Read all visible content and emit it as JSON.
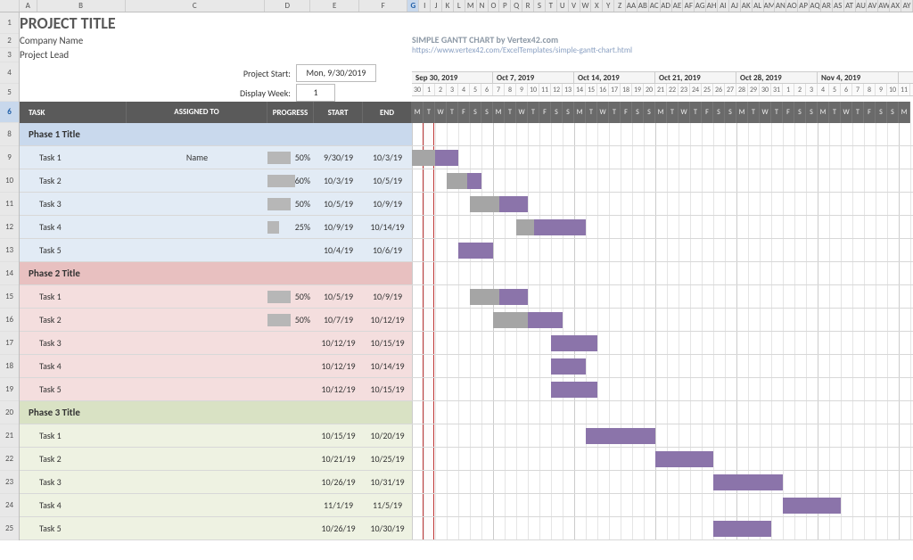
{
  "chart_data": {
    "type": "bar",
    "orientation": "horizontal-gantt",
    "title": "PROJECT TITLE",
    "x_axis": "date",
    "x_start": "2019-09-30",
    "x_end": "2019-11-11",
    "weeks": [
      "Sep 30, 2019",
      "Oct 7, 2019",
      "Oct 14, 2019",
      "Oct 21, 2019",
      "Oct 28, 2019",
      "Nov 4, 2019"
    ],
    "day_numbers": [
      30,
      1,
      2,
      3,
      4,
      5,
      6,
      7,
      8,
      9,
      10,
      11,
      12,
      13,
      14,
      15,
      16,
      17,
      18,
      19,
      20,
      21,
      22,
      23,
      24,
      25,
      26,
      27,
      28,
      29,
      30,
      31,
      1,
      2,
      3,
      4,
      5,
      6,
      7,
      8,
      9,
      10,
      11
    ],
    "dow": [
      "M",
      "T",
      "W",
      "T",
      "F",
      "S",
      "S",
      "M",
      "T",
      "W",
      "T",
      "F",
      "S",
      "S",
      "M",
      "T",
      "W",
      "T",
      "F",
      "S",
      "S",
      "M",
      "T",
      "W",
      "T",
      "F",
      "S",
      "S",
      "M",
      "T",
      "W",
      "T",
      "F",
      "S",
      "S",
      "M",
      "T",
      "W",
      "T",
      "F",
      "S",
      "S",
      "M"
    ],
    "series": [
      {
        "phase": "Phase 1 Title",
        "tasks": [
          {
            "name": "Task 1",
            "assigned": "Name",
            "progress": 50,
            "start": "9/30/19",
            "end": "10/3/19",
            "start_i": 0,
            "dur": 4
          },
          {
            "name": "Task 2",
            "assigned": "",
            "progress": 60,
            "start": "10/3/19",
            "end": "10/5/19",
            "start_i": 3,
            "dur": 3
          },
          {
            "name": "Task 3",
            "assigned": "",
            "progress": 50,
            "start": "10/5/19",
            "end": "10/9/19",
            "start_i": 5,
            "dur": 5
          },
          {
            "name": "Task 4",
            "assigned": "",
            "progress": 25,
            "start": "10/9/19",
            "end": "10/14/19",
            "start_i": 9,
            "dur": 6
          },
          {
            "name": "Task 5",
            "assigned": "",
            "progress": null,
            "start": "10/4/19",
            "end": "10/6/19",
            "start_i": 4,
            "dur": 3
          }
        ]
      },
      {
        "phase": "Phase 2 Title",
        "tasks": [
          {
            "name": "Task 1",
            "assigned": "",
            "progress": 50,
            "start": "10/5/19",
            "end": "10/9/19",
            "start_i": 5,
            "dur": 5
          },
          {
            "name": "Task 2",
            "assigned": "",
            "progress": 50,
            "start": "10/7/19",
            "end": "10/12/19",
            "start_i": 7,
            "dur": 6
          },
          {
            "name": "Task 3",
            "assigned": "",
            "progress": null,
            "start": "10/12/19",
            "end": "10/15/19",
            "start_i": 12,
            "dur": 4
          },
          {
            "name": "Task 4",
            "assigned": "",
            "progress": null,
            "start": "10/12/19",
            "end": "10/14/19",
            "start_i": 12,
            "dur": 3
          },
          {
            "name": "Task 5",
            "assigned": "",
            "progress": null,
            "start": "10/12/19",
            "end": "10/15/19",
            "start_i": 12,
            "dur": 4
          }
        ]
      },
      {
        "phase": "Phase 3 Title",
        "tasks": [
          {
            "name": "Task 1",
            "assigned": "",
            "progress": null,
            "start": "10/15/19",
            "end": "10/20/19",
            "start_i": 15,
            "dur": 6
          },
          {
            "name": "Task 2",
            "assigned": "",
            "progress": null,
            "start": "10/21/19",
            "end": "10/25/19",
            "start_i": 21,
            "dur": 5
          },
          {
            "name": "Task 3",
            "assigned": "",
            "progress": null,
            "start": "10/26/19",
            "end": "10/31/19",
            "start_i": 26,
            "dur": 6
          },
          {
            "name": "Task 4",
            "assigned": "",
            "progress": null,
            "start": "11/1/19",
            "end": "11/5/19",
            "start_i": 32,
            "dur": 5
          },
          {
            "name": "Task 5",
            "assigned": "",
            "progress": null,
            "start": "10/26/19",
            "end": "10/30/19",
            "start_i": 26,
            "dur": 5
          }
        ]
      }
    ]
  },
  "spreadsheet": {
    "col_letters": [
      "A",
      "B",
      "C",
      "D",
      "E",
      "F",
      "G",
      "I",
      "J",
      "K",
      "L",
      "M",
      "N",
      "O",
      "P",
      "Q",
      "R",
      "S",
      "T",
      "U",
      "V",
      "W",
      "X",
      "Y",
      "Z",
      "AA",
      "AB",
      "AC",
      "AD",
      "AE",
      "AF",
      "AG",
      "AH",
      "AI",
      "AJ",
      "AK",
      "AL",
      "AM",
      "AN",
      "AO",
      "AP",
      "AQ",
      "AR",
      "AS",
      "AT",
      "AU",
      "AV",
      "AW",
      "AX",
      "AY"
    ],
    "selected_col": "G",
    "row_numbers": [
      1,
      2,
      3,
      4,
      5,
      6,
      8,
      9,
      10,
      11,
      12,
      13,
      14,
      15,
      16,
      17,
      18,
      19,
      20,
      21,
      22,
      23,
      24,
      25
    ],
    "selected_row": 6
  },
  "header": {
    "title": "PROJECT TITLE",
    "company": "Company Name",
    "lead": "Project Lead",
    "project_start_label": "Project Start:",
    "project_start_value": "Mon, 9/30/2019",
    "display_week_label": "Display Week:",
    "display_week_value": "1",
    "credit_line": "SIMPLE GANTT CHART by Vertex42.com",
    "credit_url": "https://www.vertex42.com/ExcelTemplates/simple-gantt-chart.html"
  },
  "columns": {
    "task": "TASK",
    "assigned": "ASSIGNED TO",
    "progress": "PROGRESS",
    "start": "START",
    "end": "END"
  },
  "layout": {
    "task_w": 120,
    "assigned_w": 158,
    "progress_w": 52,
    "start_w": 55,
    "end_w": 55,
    "day_w": 13,
    "left_total": 440
  }
}
